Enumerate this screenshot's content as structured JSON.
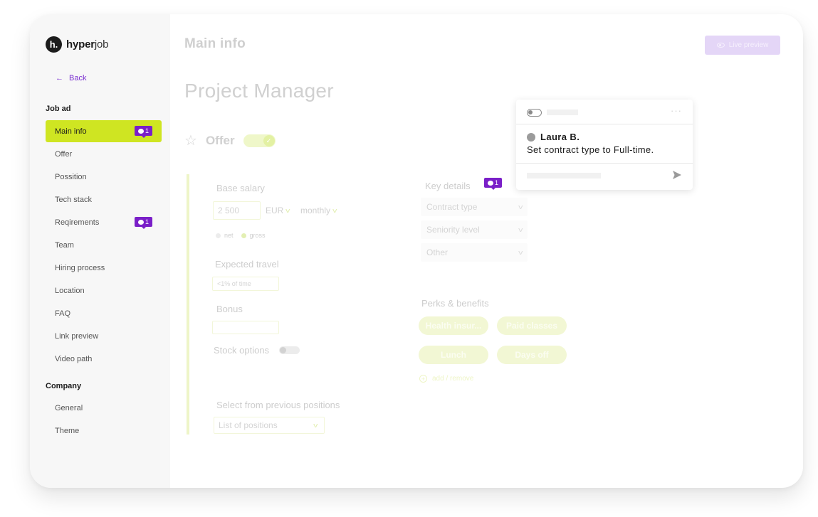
{
  "app": {
    "logo_mark": "h.",
    "logo_bold": "hyper",
    "logo_light": "job"
  },
  "sidebar": {
    "back_label": "Back",
    "sections": [
      {
        "title": "Job ad",
        "items": [
          {
            "label": "Main info",
            "active": true,
            "comments": "1"
          },
          {
            "label": "Offer"
          },
          {
            "label": "Possition"
          },
          {
            "label": "Tech stack"
          },
          {
            "label": "Reqirements",
            "comments": "1"
          },
          {
            "label": "Team"
          },
          {
            "label": "Hiring process"
          },
          {
            "label": "Location"
          },
          {
            "label": "FAQ"
          },
          {
            "label": "Link preview"
          },
          {
            "label": "Video path"
          }
        ]
      },
      {
        "title": "Company",
        "items": [
          {
            "label": "General"
          },
          {
            "label": "Theme"
          }
        ]
      }
    ]
  },
  "header": {
    "title": "Main info",
    "live_preview_label": "Live preview"
  },
  "job": {
    "title": "Project Manager",
    "offer_label": "Offer",
    "offer_enabled": true
  },
  "offer": {
    "base_salary_label": "Base salary",
    "salary_value": "2 500",
    "currency": "EUR",
    "period": "monthly",
    "net_label": "net",
    "gross_label": "gross",
    "selected_basis": "gross",
    "expected_travel_label": "Expected travel",
    "expected_travel_value": "<1% of time",
    "bonus_label": "Bonus",
    "bonus_value": "",
    "stock_options_label": "Stock options",
    "stock_options_enabled": false,
    "previous_positions_label": "Select from previous positions",
    "previous_positions_placeholder": "List of positions"
  },
  "key_details": {
    "title": "Key details",
    "comments": "1",
    "selects": [
      "Contract type",
      "Seniority level",
      "Other"
    ]
  },
  "perks": {
    "title": "Perks & benefits",
    "chips": [
      "Health insur...",
      "Paid classes",
      "Lunch",
      "Days off"
    ],
    "add_remove_label": "add / remove"
  },
  "comment_popup": {
    "author": "Laura B.",
    "text": "Set contract type to Full-time."
  },
  "colors": {
    "accent_lime": "#cfe522",
    "badge_purple": "#7a1fc8",
    "link_purple": "#7a2fd0"
  }
}
